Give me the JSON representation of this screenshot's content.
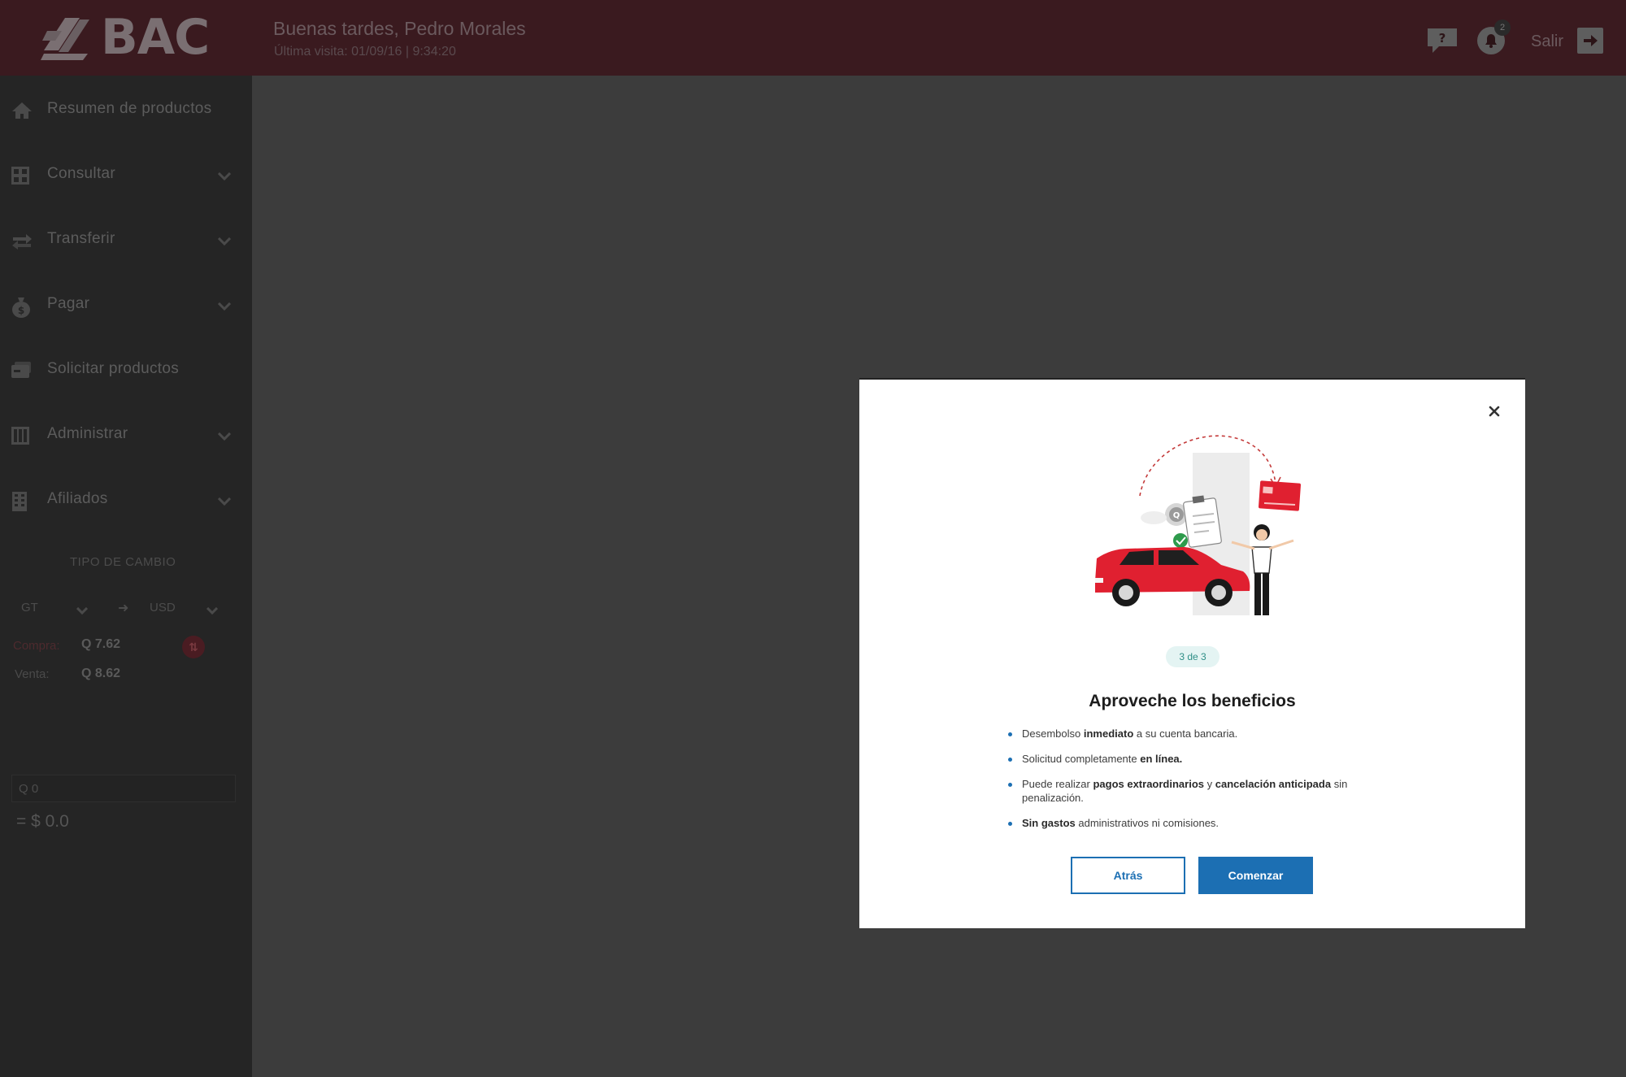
{
  "header": {
    "brand": "BAC",
    "greeting": "Buenas tardes, Pedro Morales",
    "last_visit": "Última visita: 01/09/16  |  9:34:20",
    "notification_count": "2",
    "exit_label": "Salir"
  },
  "sidebar": {
    "items": [
      {
        "label": "Resumen de productos",
        "icon": "home-icon",
        "has_submenu": false
      },
      {
        "label": "Consultar",
        "icon": "grid-icon",
        "has_submenu": true
      },
      {
        "label": "Transferir",
        "icon": "transfer-arrows-icon",
        "has_submenu": true
      },
      {
        "label": "Pagar",
        "icon": "money-bag-icon",
        "has_submenu": true
      },
      {
        "label": "Solicitar productos",
        "icon": "request-card-icon",
        "has_submenu": false
      },
      {
        "label": "Administrar",
        "icon": "admin-grid-icon",
        "has_submenu": true
      },
      {
        "label": "Afiliados",
        "icon": "building-icon",
        "has_submenu": true
      }
    ]
  },
  "exchange": {
    "title": "TIPO DE CAMBIO",
    "from_currency": "GT",
    "to_currency": "USD",
    "buy_label": "Compra:",
    "buy_value": "Q 7.62",
    "sell_label": "Venta:",
    "sell_value": "Q 8.62",
    "input_value": "Q 0",
    "result": "= $ 0.0"
  },
  "modal": {
    "step": "3 de 3",
    "title": "Aproveche los beneficios",
    "benefits": [
      {
        "pre": "Desembolso ",
        "bold": "inmediato",
        "post": " a su cuenta bancaria."
      },
      {
        "pre": "Solicitud completamente ",
        "bold": "en línea.",
        "post": ""
      },
      {
        "pre": "Puede realizar ",
        "bold": "pagos extraordinarios",
        "mid": " y ",
        "bold2": "cancelación anticipada",
        "post": " sin penalización."
      },
      {
        "pre": "",
        "bold": "Sin gastos",
        "post": " administrativos ni comisiones."
      }
    ],
    "back_label": "Atrás",
    "start_label": "Comenzar"
  },
  "colors": {
    "header_bg": "#3a1a1f",
    "sidebar_bg": "#252525",
    "overlay_bg": "#3c3c3c",
    "primary_blue": "#1c6fb3",
    "brand_red": "#e02030",
    "step_pill_bg": "#e4f4f3"
  }
}
